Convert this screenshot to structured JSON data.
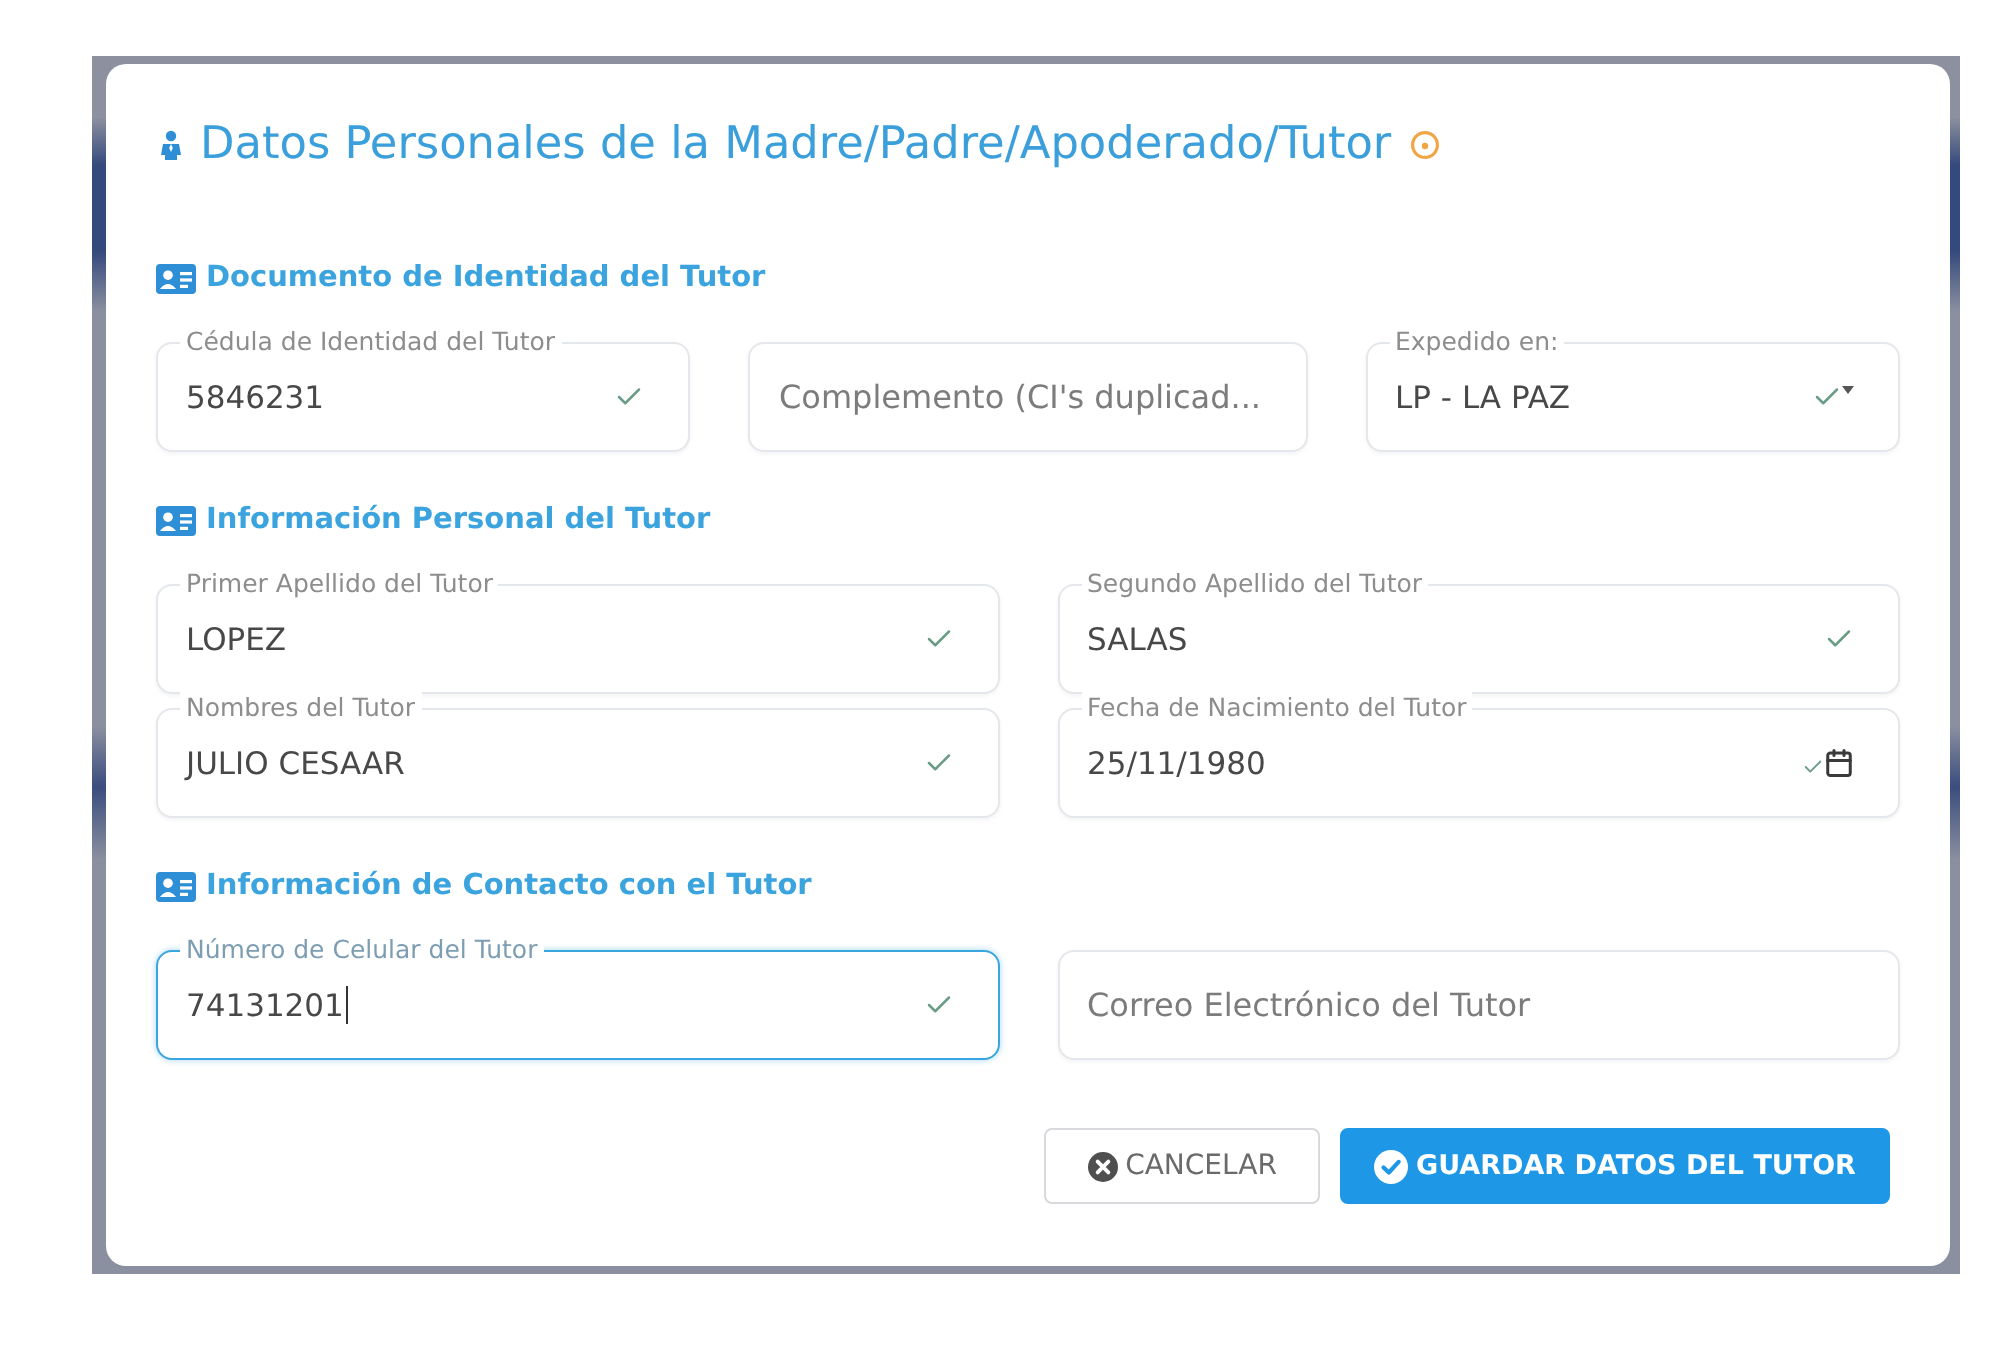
{
  "dialog": {
    "title": "Datos Personales de la Madre/Padre/Apoderado/Tutor",
    "sections": [
      {
        "heading": "Documento de Identidad del Tutor",
        "rows": [
          [
            {
              "kind": "text",
              "label": "Cédula de Identidad del Tutor",
              "value": "5846231",
              "valid": true,
              "focused": false
            },
            {
              "kind": "text",
              "placeholder": "Complemento (CI's duplicad...",
              "valid": false,
              "focused": false
            },
            {
              "kind": "select",
              "label": "Expedido en:",
              "value": "LP - LA PAZ",
              "valid": true,
              "focused": false
            }
          ]
        ]
      },
      {
        "heading": "Información Personal del Tutor",
        "rows": [
          [
            {
              "kind": "text",
              "label": "Primer Apellido del Tutor",
              "value": "LOPEZ",
              "valid": true,
              "focused": false
            },
            {
              "kind": "text",
              "label": "Segundo Apellido del Tutor",
              "value": "SALAS",
              "valid": true,
              "focused": false
            }
          ],
          [
            {
              "kind": "text",
              "label": "Nombres del Tutor",
              "value": "JULIO CESAAR",
              "valid": true,
              "focused": false
            },
            {
              "kind": "date",
              "label": "Fecha de Nacimiento del Tutor",
              "value": "25/11/1980",
              "valid": true,
              "focused": false
            }
          ]
        ]
      },
      {
        "heading": "Información de Contacto con el Tutor",
        "rows": [
          [
            {
              "kind": "text",
              "label": "Número de Celular del Tutor",
              "value": "74131201",
              "valid": true,
              "focused": true
            },
            {
              "kind": "text",
              "placeholder": "Correo Electrónico del Tutor",
              "valid": false,
              "focused": false
            }
          ]
        ]
      }
    ],
    "buttons": [
      {
        "kind": "cancel",
        "label": "CANCELAR"
      },
      {
        "kind": "save",
        "label": "GUARDAR DATOS DEL TUTOR"
      }
    ]
  }
}
